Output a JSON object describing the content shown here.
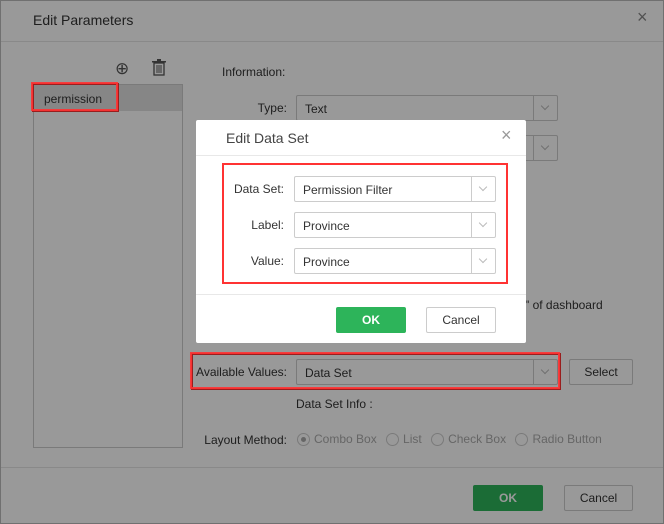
{
  "outer": {
    "title": "Edit Parameters",
    "list": [
      "permission"
    ],
    "information_label": "Information:",
    "type_label": "Type:",
    "type_value": "Text",
    "partial_text": "\" of dashboard",
    "available_values_label": "Available Values:",
    "available_values_value": "Data Set",
    "select_button": "Select",
    "data_set_info": "Data Set Info :",
    "layout_method_label": "Layout Method:",
    "layout_options": [
      "Combo Box",
      "List",
      "Check Box",
      "Radio Button"
    ],
    "layout_selected": "Combo Box",
    "ok": "OK",
    "cancel": "Cancel"
  },
  "dialog": {
    "title": "Edit Data Set",
    "data_set_label": "Data Set:",
    "data_set_value": "Permission Filter",
    "label_label": "Label:",
    "label_value": "Province",
    "value_label": "Value:",
    "value_value": "Province",
    "ok": "OK",
    "cancel": "Cancel"
  },
  "colors": {
    "accent": "#2db45a",
    "highlight": "#ff3333"
  }
}
